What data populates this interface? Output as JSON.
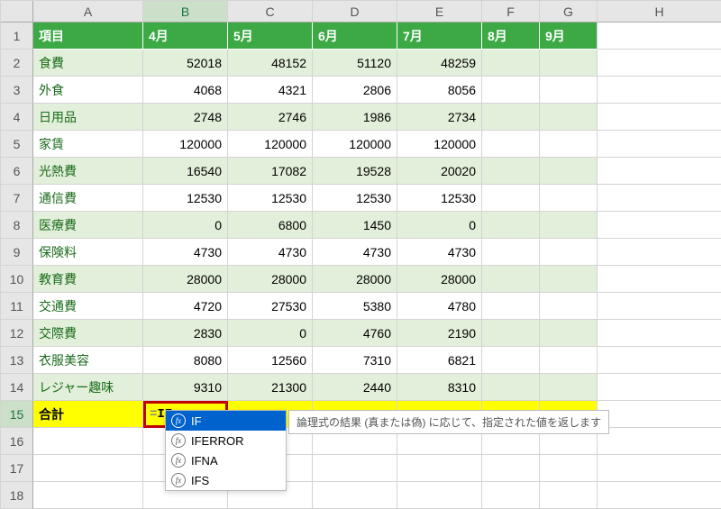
{
  "columns": [
    "A",
    "B",
    "C",
    "D",
    "E",
    "F",
    "G",
    "H"
  ],
  "header_row": {
    "item_label": "項目",
    "months": [
      "4月",
      "5月",
      "6月",
      "7月",
      "8月",
      "9月"
    ]
  },
  "rows": [
    {
      "item": "食費",
      "vals": [
        "52018",
        "48152",
        "51120",
        "48259"
      ]
    },
    {
      "item": "外食",
      "vals": [
        "4068",
        "4321",
        "2806",
        "8056"
      ]
    },
    {
      "item": "日用品",
      "vals": [
        "2748",
        "2746",
        "1986",
        "2734"
      ]
    },
    {
      "item": "家賃",
      "vals": [
        "120000",
        "120000",
        "120000",
        "120000"
      ]
    },
    {
      "item": "光熱費",
      "vals": [
        "16540",
        "17082",
        "19528",
        "20020"
      ]
    },
    {
      "item": "通信費",
      "vals": [
        "12530",
        "12530",
        "12530",
        "12530"
      ]
    },
    {
      "item": "医療費",
      "vals": [
        "0",
        "6800",
        "1450",
        "0"
      ]
    },
    {
      "item": "保険料",
      "vals": [
        "4730",
        "4730",
        "4730",
        "4730"
      ]
    },
    {
      "item": "教育費",
      "vals": [
        "28000",
        "28000",
        "28000",
        "28000"
      ]
    },
    {
      "item": "交通費",
      "vals": [
        "4720",
        "27530",
        "5380",
        "4780"
      ]
    },
    {
      "item": "交際費",
      "vals": [
        "2830",
        "0",
        "4760",
        "2190"
      ]
    },
    {
      "item": "衣服美容",
      "vals": [
        "8080",
        "12560",
        "7310",
        "6821"
      ]
    },
    {
      "item": "レジャー趣味",
      "vals": [
        "9310",
        "21300",
        "2440",
        "8310"
      ]
    }
  ],
  "total_row": {
    "label": "合計"
  },
  "active_cell": {
    "prefix": "=",
    "text": "IF"
  },
  "autocomplete": {
    "items": [
      {
        "label": "IF",
        "selected": true
      },
      {
        "label": "IFERROR",
        "selected": false
      },
      {
        "label": "IFNA",
        "selected": false
      },
      {
        "label": "IFS",
        "selected": false
      }
    ],
    "tooltip": "論理式の結果 (真または偽) に応じて、指定された値を返します"
  },
  "chart_data": {
    "type": "table",
    "title": "",
    "columns": [
      "項目",
      "4月",
      "5月",
      "6月",
      "7月",
      "8月",
      "9月"
    ],
    "data": [
      [
        "食費",
        52018,
        48152,
        51120,
        48259,
        null,
        null
      ],
      [
        "外食",
        4068,
        4321,
        2806,
        8056,
        null,
        null
      ],
      [
        "日用品",
        2748,
        2746,
        1986,
        2734,
        null,
        null
      ],
      [
        "家賃",
        120000,
        120000,
        120000,
        120000,
        null,
        null
      ],
      [
        "光熱費",
        16540,
        17082,
        19528,
        20020,
        null,
        null
      ],
      [
        "通信費",
        12530,
        12530,
        12530,
        12530,
        null,
        null
      ],
      [
        "医療費",
        0,
        6800,
        1450,
        0,
        null,
        null
      ],
      [
        "保険料",
        4730,
        4730,
        4730,
        4730,
        null,
        null
      ],
      [
        "教育費",
        28000,
        28000,
        28000,
        28000,
        null,
        null
      ],
      [
        "交通費",
        4720,
        27530,
        5380,
        4780,
        null,
        null
      ],
      [
        "交際費",
        2830,
        0,
        4760,
        2190,
        null,
        null
      ],
      [
        "衣服美容",
        8080,
        12560,
        7310,
        6821,
        null,
        null
      ],
      [
        "レジャー趣味",
        9310,
        21300,
        2440,
        8310,
        null,
        null
      ],
      [
        "合計",
        null,
        null,
        null,
        null,
        null,
        null
      ]
    ]
  }
}
